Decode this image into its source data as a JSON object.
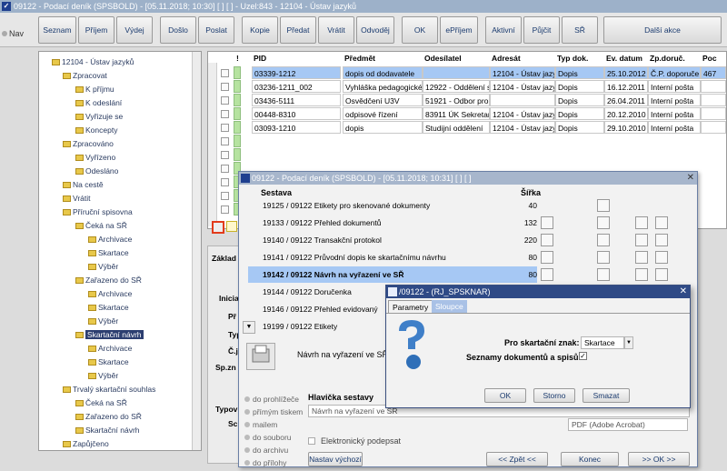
{
  "window": {
    "title": "09122 - Podací deník (SPSBOLD) - [05.11.2018; 10:30]  [  ]  [  ] - Uzel:843 - 12104 - Ústav jazyků"
  },
  "nav": {
    "label": "Nav"
  },
  "toolbar": {
    "buttons": [
      "Seznam",
      "Příjem",
      "Výdej",
      "Došlo",
      "Poslat",
      "Kopie",
      "Předat",
      "Vrátit",
      "Odvoděj",
      "OK",
      "ePříjem",
      "Aktivní",
      "Půjčit",
      "SŘ",
      "Další akce"
    ]
  },
  "tree": {
    "items": [
      {
        "label": "12104 - Ústav jazyků"
      },
      {
        "label": "Zpracovat"
      },
      {
        "label": "K příjmu"
      },
      {
        "label": "K odeslání"
      },
      {
        "label": "Vyřizuje se"
      },
      {
        "label": "Koncepty"
      },
      {
        "label": "Zpracováno"
      },
      {
        "label": "Vyřízeno"
      },
      {
        "label": "Odesláno"
      },
      {
        "label": "Na cestě"
      },
      {
        "label": "Vrátit"
      },
      {
        "label": "Příruční spisovna"
      },
      {
        "label": "Čeká na SŘ"
      },
      {
        "label": "Archivace"
      },
      {
        "label": "Skartace"
      },
      {
        "label": "Výběr"
      },
      {
        "label": "Zařazeno do SŘ"
      },
      {
        "label": "Archivace"
      },
      {
        "label": "Skartace"
      },
      {
        "label": "Výběr"
      },
      {
        "label": "Skartační návrh"
      },
      {
        "label": "Archivace"
      },
      {
        "label": "Skartace"
      },
      {
        "label": "Výběr"
      },
      {
        "label": "Trvalý skartační souhlas"
      },
      {
        "label": "Čeká na SŘ"
      },
      {
        "label": "Zařazeno do SŘ"
      },
      {
        "label": "Skartační návrh"
      },
      {
        "label": "Zapůjčeno"
      }
    ]
  },
  "grid": {
    "headers": [
      "!",
      "PID",
      "Předmět",
      "Odesílatel",
      "Adresát",
      "Typ dok.",
      "Ev. datum",
      "Zp.doruč.",
      "Poc"
    ],
    "rows": [
      {
        "pid": "03339-1212",
        "predmet": "dopis od dodavatele",
        "odesilatel": "",
        "adresat": "12104 - Ústav jazy",
        "typ": "Dopis",
        "datum": "25.10.2012",
        "zp": "Č.P. doporuče",
        "poc": "467"
      },
      {
        "pid": "03236-1211_002",
        "predmet": "Vyhláška pedagogické",
        "odesilatel": "12922 - Oddělení s",
        "adresat": "12104 - Ústav jazy",
        "typ": "Dopis",
        "datum": "16.12.2011",
        "zp": "Interní pošta",
        "poc": ""
      },
      {
        "pid": "03436-5111",
        "predmet": "Osvědčení U3V",
        "odesilatel": "51921 - Odbor pro",
        "adresat": "",
        "typ": "Dopis",
        "datum": "26.04.2011",
        "zp": "Interní pošta",
        "poc": ""
      },
      {
        "pid": "00448-8310",
        "predmet": "odpisové řízení",
        "odesilatel": "83911 ÚK Sekretar",
        "adresat": "12104 - Ústav jazy",
        "typ": "Dopis",
        "datum": "20.12.2010",
        "zp": "Interní pošta",
        "poc": ""
      },
      {
        "pid": "03093-1210",
        "predmet": "dopis",
        "odesilatel": "Studijní oddělení",
        "adresat": "12104 - Ústav jazy",
        "typ": "Dopis",
        "datum": "29.10.2010",
        "zp": "Interní pošta",
        "poc": ""
      }
    ]
  },
  "detail": {
    "labels": [
      "Základ",
      "Inicia",
      "Př",
      "Typ",
      "Č.j",
      "Sp.zn",
      "Typov",
      "Sc"
    ]
  },
  "dialog1": {
    "title": "09122 - Podací deník (SPSBOLD) - [05.11.2018; 10:31]  [  ]  [  ]",
    "col_sestava": "Sestava",
    "col_sirka": "Šířka",
    "reports": [
      {
        "label": "19125 / 09122   Etikety pro skenované dokumenty",
        "sirka": "40"
      },
      {
        "label": "19133 / 09122   Přehled dokumentů",
        "sirka": "132"
      },
      {
        "label": "19140 / 09122   Transakční protokol",
        "sirka": "220"
      },
      {
        "label": "19141 / 09122   Průvodní dopis ke skartačnímu návrhu",
        "sirka": "80"
      },
      {
        "label": "19142 / 09122   Návrh na vyřazení ve SŘ",
        "sirka": "80"
      },
      {
        "label": "19144 / 09122   Doručenka",
        "sirka": ""
      },
      {
        "label": "19146 / 09122   Přehled evidovaný",
        "sirka": ""
      },
      {
        "label": "19199 / 09122   Etikety",
        "sirka": ""
      }
    ],
    "preview_text": "Návrh na vyřazení ve SŘ",
    "radios": [
      "do prohlížeče",
      "přímým tiskem",
      "mailem",
      "do souboru",
      "do archivu",
      "do přílohy"
    ],
    "header_label": "Hlavička sestavy",
    "header_value": "Návrh na vyřazení ve SŘ",
    "format_value": "PDF (Adobe Acrobat)",
    "sign_label": "Elektronický podepsat",
    "btn_settings": "Nastav výchozí",
    "btn_prev": "<< Zpět <<",
    "btn_end": "Konec",
    "btn_ok": ">> OK >>"
  },
  "dialog2": {
    "title": "/09122 - (RJ_SPSKNAR)",
    "tabs": [
      "Parametry",
      "Sloupce"
    ],
    "label_znak": "Pro skartační znak:",
    "value_znak": "Skartace",
    "label_seznamy": "Seznamy dokumentů a spisů:",
    "btn_ok": "OK",
    "btn_storno": "Storno",
    "btn_smazat": "Smazat"
  },
  "colors": {
    "title_bar": "#9db1c9",
    "dialog2_title": "#2f4a86",
    "selected_row": "#a6c8f4"
  }
}
